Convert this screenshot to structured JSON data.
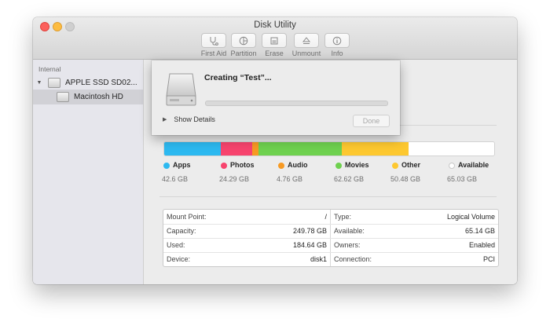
{
  "window": {
    "title": "Disk Utility"
  },
  "toolbar": {
    "items": [
      {
        "label": "First Aid",
        "icon": "stethoscope-icon"
      },
      {
        "label": "Partition",
        "icon": "pie-icon"
      },
      {
        "label": "Erase",
        "icon": "erase-icon"
      },
      {
        "label": "Unmount",
        "icon": "eject-icon"
      },
      {
        "label": "Info",
        "icon": "info-icon"
      }
    ]
  },
  "sidebar": {
    "section": "Internal",
    "disk": "APPLE SSD SD02...",
    "volume": "Macintosh HD"
  },
  "usage": {
    "categories": [
      {
        "name": "Apps",
        "value": "42.6 GB",
        "gb": 42.6,
        "color": "#2db9f0"
      },
      {
        "name": "Photos",
        "value": "24.29 GB",
        "gb": 24.29,
        "color": "#f7446e"
      },
      {
        "name": "Audio",
        "value": "4.76 GB",
        "gb": 4.76,
        "color": "#f79a23"
      },
      {
        "name": "Movies",
        "value": "62.62 GB",
        "gb": 62.62,
        "color": "#6fd14f"
      },
      {
        "name": "Other",
        "value": "50.48 GB",
        "gb": 50.48,
        "color": "#fdc830"
      },
      {
        "name": "Available",
        "value": "65.03 GB",
        "gb": 65.03,
        "color": "#ffffff"
      }
    ]
  },
  "info": {
    "left": [
      {
        "label": "Mount Point:",
        "value": "/"
      },
      {
        "label": "Capacity:",
        "value": "249.78 GB"
      },
      {
        "label": "Used:",
        "value": "184.64 GB"
      },
      {
        "label": "Device:",
        "value": "disk1"
      }
    ],
    "right": [
      {
        "label": "Type:",
        "value": "Logical Volume"
      },
      {
        "label": "Available:",
        "value": "65.14 GB"
      },
      {
        "label": "Owners:",
        "value": "Enabled"
      },
      {
        "label": "Connection:",
        "value": "PCI"
      }
    ]
  },
  "sheet": {
    "title": "Creating “Test”...",
    "progress": 0,
    "details_label": "Show Details",
    "done_label": "Done"
  }
}
